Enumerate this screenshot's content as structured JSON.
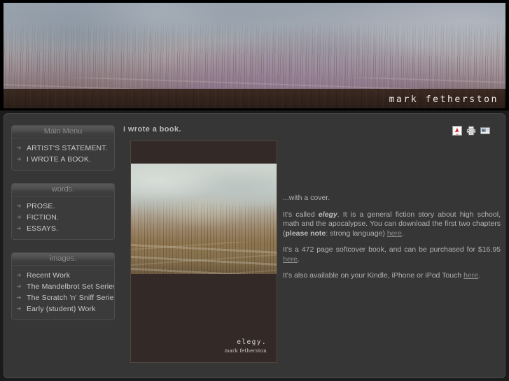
{
  "site": {
    "name": "mark fetherston",
    "banner_alt": "misty winter landscape with bare trees"
  },
  "sidebar": {
    "modules": [
      {
        "title": "Main Menu",
        "items": [
          {
            "label": "ARTIST'S STATEMENT.",
            "icon": "arrow-bullet-icon"
          },
          {
            "label": "I WROTE A BOOK.",
            "icon": "arrow-bullet-icon"
          }
        ]
      },
      {
        "title": "words.",
        "items": [
          {
            "label": "PROSE.",
            "icon": "arrow-bullet-icon"
          },
          {
            "label": "FICTION.",
            "icon": "arrow-bullet-icon"
          },
          {
            "label": "ESSAYS.",
            "icon": "arrow-bullet-icon"
          }
        ]
      },
      {
        "title": "images.",
        "items": [
          {
            "label": "Recent Work",
            "icon": "arrow-bullet-icon"
          },
          {
            "label": "The Mandelbrot Set Series",
            "icon": "arrow-bullet-icon"
          },
          {
            "label": "The Scratch 'n' Sniff Series",
            "icon": "arrow-bullet-icon"
          },
          {
            "label": "Early (student) Work",
            "icon": "arrow-bullet-icon"
          }
        ]
      }
    ]
  },
  "content": {
    "title": "i wrote a book.",
    "tools": [
      {
        "name": "pdf-icon",
        "label": "PDF"
      },
      {
        "name": "print-icon",
        "label": "Print"
      },
      {
        "name": "email-icon",
        "label": "E-mail"
      }
    ],
    "cover": {
      "title": "elegy.",
      "author": "mark fetherston"
    },
    "paragraphs": [
      {
        "id": "p1",
        "runs": [
          {
            "t": "...with a cover.",
            "style": "plain"
          }
        ]
      },
      {
        "id": "p2",
        "runs": [
          {
            "t": "It's called ",
            "style": "plain"
          },
          {
            "t": "elegy",
            "style": "em"
          },
          {
            "t": ". It is a general fiction story about high school, math and the apocalypse.  You can download the first two chapters (",
            "style": "plain"
          },
          {
            "t": "please note",
            "style": "strong"
          },
          {
            "t": ": strong language) ",
            "style": "plain"
          },
          {
            "t": "here",
            "style": "link"
          },
          {
            "t": ".",
            "style": "plain"
          }
        ]
      },
      {
        "id": "p3",
        "runs": [
          {
            "t": "It's a 472 page softcover book, and can be purchased for $16.95 ",
            "style": "plain"
          },
          {
            "t": "here",
            "style": "link"
          },
          {
            "t": ".",
            "style": "plain"
          }
        ]
      },
      {
        "id": "p4",
        "runs": [
          {
            "t": "It's also available on your Kindle, iPhone or iPod Touch ",
            "style": "plain"
          },
          {
            "t": "here",
            "style": "link"
          },
          {
            "t": ".",
            "style": "plain"
          }
        ]
      }
    ]
  },
  "colors": {
    "page_background": "#1b1b1b",
    "panel_background": "#363636",
    "module_background": "#3b3b3b",
    "module_border": "#4d4d4d",
    "text": "#b1b1b1",
    "menu_text": "#c9c9c9",
    "module_title": "#8f8f8f",
    "link": "#8d8d8d",
    "namebar": "#2b1e18",
    "name_text": "#efeae4"
  }
}
